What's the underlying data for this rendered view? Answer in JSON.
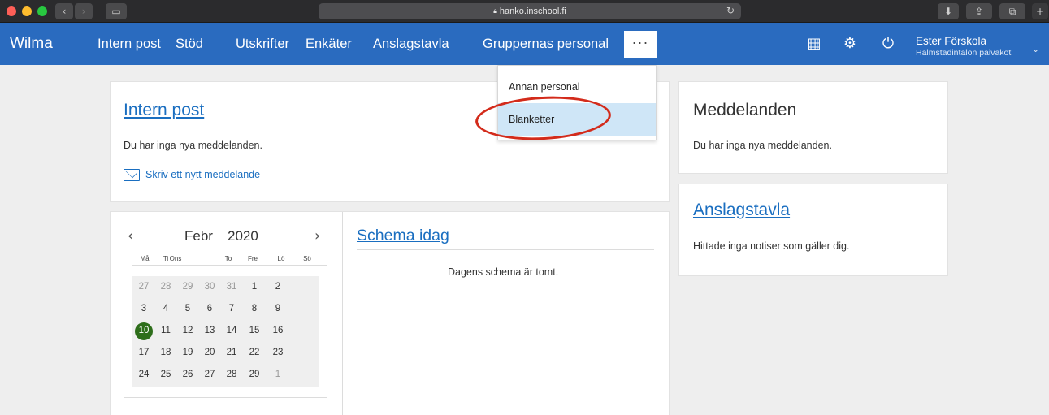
{
  "browser": {
    "url": "hanko.inschool.fi",
    "icons": [
      "back-icon",
      "forward-icon",
      "sidebar-icon",
      "lock-icon",
      "reload-icon",
      "download-icon",
      "share-icon",
      "tabs-icon",
      "new-tab-icon"
    ]
  },
  "nav": {
    "brand": "Wilma",
    "items": [
      "Intern post",
      "Stöd",
      "Utskrifter",
      "Enkäter",
      "Anslagstavla",
      "Gruppernas personal"
    ],
    "more": "···",
    "user_name": "Ester Förskola",
    "user_school": "Halmstadintalon päiväkoti",
    "icons": [
      "qr-code-icon",
      "roles-icon",
      "power-icon",
      "chevron-down-icon"
    ],
    "accent": "#2a6bbf"
  },
  "dropdown": {
    "items": [
      "Annan personal",
      "Blanketter"
    ],
    "selected": "Blanketter"
  },
  "intern_post": {
    "title": "Intern post",
    "text": "Du har inga nya meddelanden.",
    "new_message_link": "Skriv ett nytt meddelande"
  },
  "meddelanden": {
    "title": "Meddelanden",
    "text": "Du har inga nya meddelanden."
  },
  "anslagstavla": {
    "title": "Anslagstavla",
    "text": "Hittade inga notiser som gäller dig."
  },
  "calendar": {
    "prev": "‹",
    "next": "›",
    "month": "Febr",
    "year": "2020",
    "weekdays": [
      "Må",
      "Ti",
      "Ons",
      "To",
      "Fre",
      "Lö",
      "Sö"
    ],
    "today": "10",
    "today_color": "#2e6e1b",
    "weeks": [
      [
        "27",
        "28",
        "29",
        "30",
        "31",
        "1",
        "2"
      ],
      [
        "3",
        "4",
        "5",
        "6",
        "7",
        "8",
        "9"
      ],
      [
        "10",
        "11",
        "12",
        "13",
        "14",
        "15",
        "16"
      ],
      [
        "17",
        "18",
        "19",
        "20",
        "21",
        "22",
        "23"
      ],
      [
        "24",
        "25",
        "26",
        "27",
        "28",
        "29",
        "1"
      ]
    ]
  },
  "schedule": {
    "title": "Schema idag",
    "text": "Dagens schema är tomt."
  }
}
